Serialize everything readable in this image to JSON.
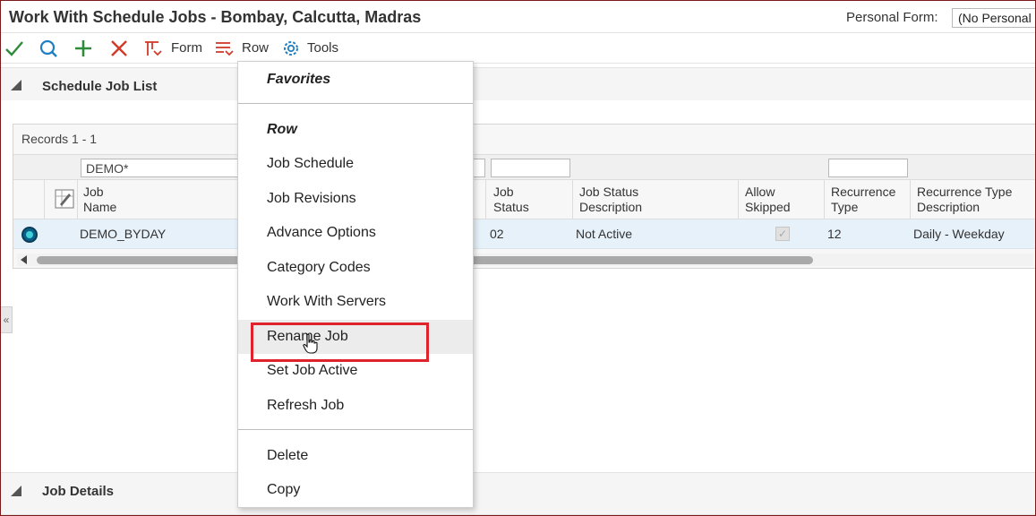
{
  "window": {
    "title": "Work With Schedule Jobs - Bombay, Calcutta, Madras",
    "personal_form_label": "Personal Form:",
    "personal_form_value": "(No Personal"
  },
  "toolbar": {
    "form_label": "Form",
    "row_label": "Row",
    "tools_label": "Tools"
  },
  "sections": {
    "list_title": "Schedule Job List",
    "details_title": "Job Details"
  },
  "grid": {
    "records_text": "Records 1 - 1",
    "filter_job_name": "DEMO*",
    "headers": {
      "job_name": "Job\nName",
      "job_status": "Job\nStatus",
      "job_status_desc": "Job Status\nDescription",
      "allow_skipped": "Allow\nSkipped",
      "recurrence_type": "Recurrence\nType",
      "recurrence_type_desc": "Recurrence Type\nDescription"
    },
    "rows": [
      {
        "job_name": "DEMO_BYDAY",
        "job_status": "02",
        "job_status_desc": "Not Active",
        "allow_skipped": true,
        "recurrence_type": "12",
        "recurrence_type_desc": "Daily - Weekday"
      }
    ]
  },
  "menu": {
    "favorites_header": "Favorites",
    "row_header": "Row",
    "items": [
      "Job Schedule",
      "Job Revisions",
      "Advance Options",
      "Category Codes",
      "Work With Servers",
      "Rename Job",
      "Set Job Active",
      "Refresh Job"
    ],
    "bottom_items": [
      "Delete",
      "Copy"
    ],
    "hovered_item": "Rename Job"
  },
  "colors": {
    "highlight": "#e0222d",
    "ok_green": "#2e8b3a",
    "cancel_red": "#d23a2a",
    "search_blue": "#1f7fc2",
    "selected_row": "#e6f1fa"
  },
  "icons": {
    "ok": "checkmark-icon",
    "find": "search-icon",
    "add": "plus-icon",
    "close": "x-icon",
    "form": "form-menu-icon",
    "row": "row-menu-icon",
    "tools": "gear-icon",
    "grid_options": "pencil-grid-icon",
    "collapse": "collapse-triangle-icon",
    "cursor": "hand-cursor-icon"
  }
}
